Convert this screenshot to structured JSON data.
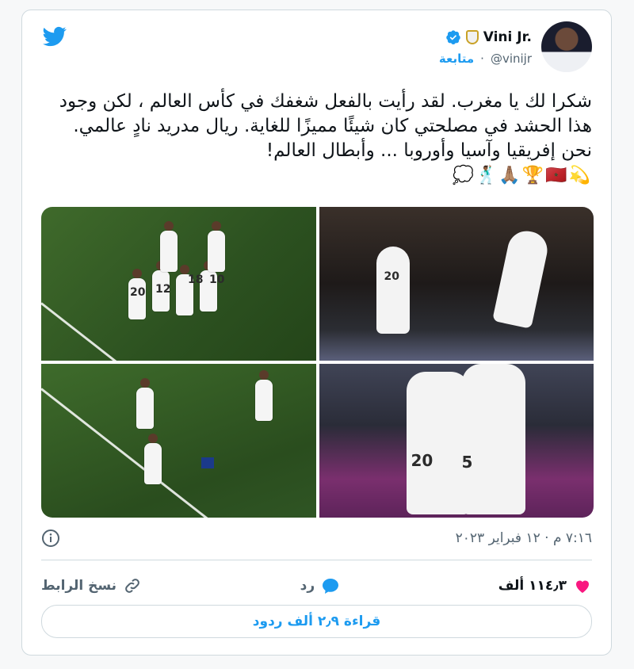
{
  "author": {
    "name": "Vini Jr.",
    "handle": "@vinijr",
    "follow_label": "متابعة",
    "separator": "·"
  },
  "tweet": {
    "text": "شكرا لك يا مغرب. لقد رأيت بالفعل شغفك في كأس العالم ، لكن وجود هذا الحشد في مصلحتي كان شيئًا مميزًا للغاية. ريال مدريد نادٍ عالمي. نحن إفريقيا وآسيا وأوروبا ... وأبطال العالم!",
    "emojis": "💫🇲🇦🏆🙏🏽🕺🏾💭",
    "media_numbers": [
      "20",
      "12",
      "18",
      "10",
      "20",
      "5"
    ]
  },
  "timestamp": "٧:١٦ م · ١٢ فبراير ٢٠٢٣",
  "actions": {
    "like_count": "١١٤٫٣ ألف",
    "reply_label": "رد",
    "copy_link_label": "نسخ الرابط"
  },
  "read_replies_label": "قراءة ٢٫٩ ألف ردود",
  "colors": {
    "accent": "#1d9bf0",
    "like": "#f91880",
    "border": "#cfd9de"
  },
  "icons": [
    "twitter-bird-icon",
    "verified-badge-icon",
    "club-crest-icon",
    "info-icon",
    "heart-icon",
    "reply-icon",
    "link-icon"
  ]
}
